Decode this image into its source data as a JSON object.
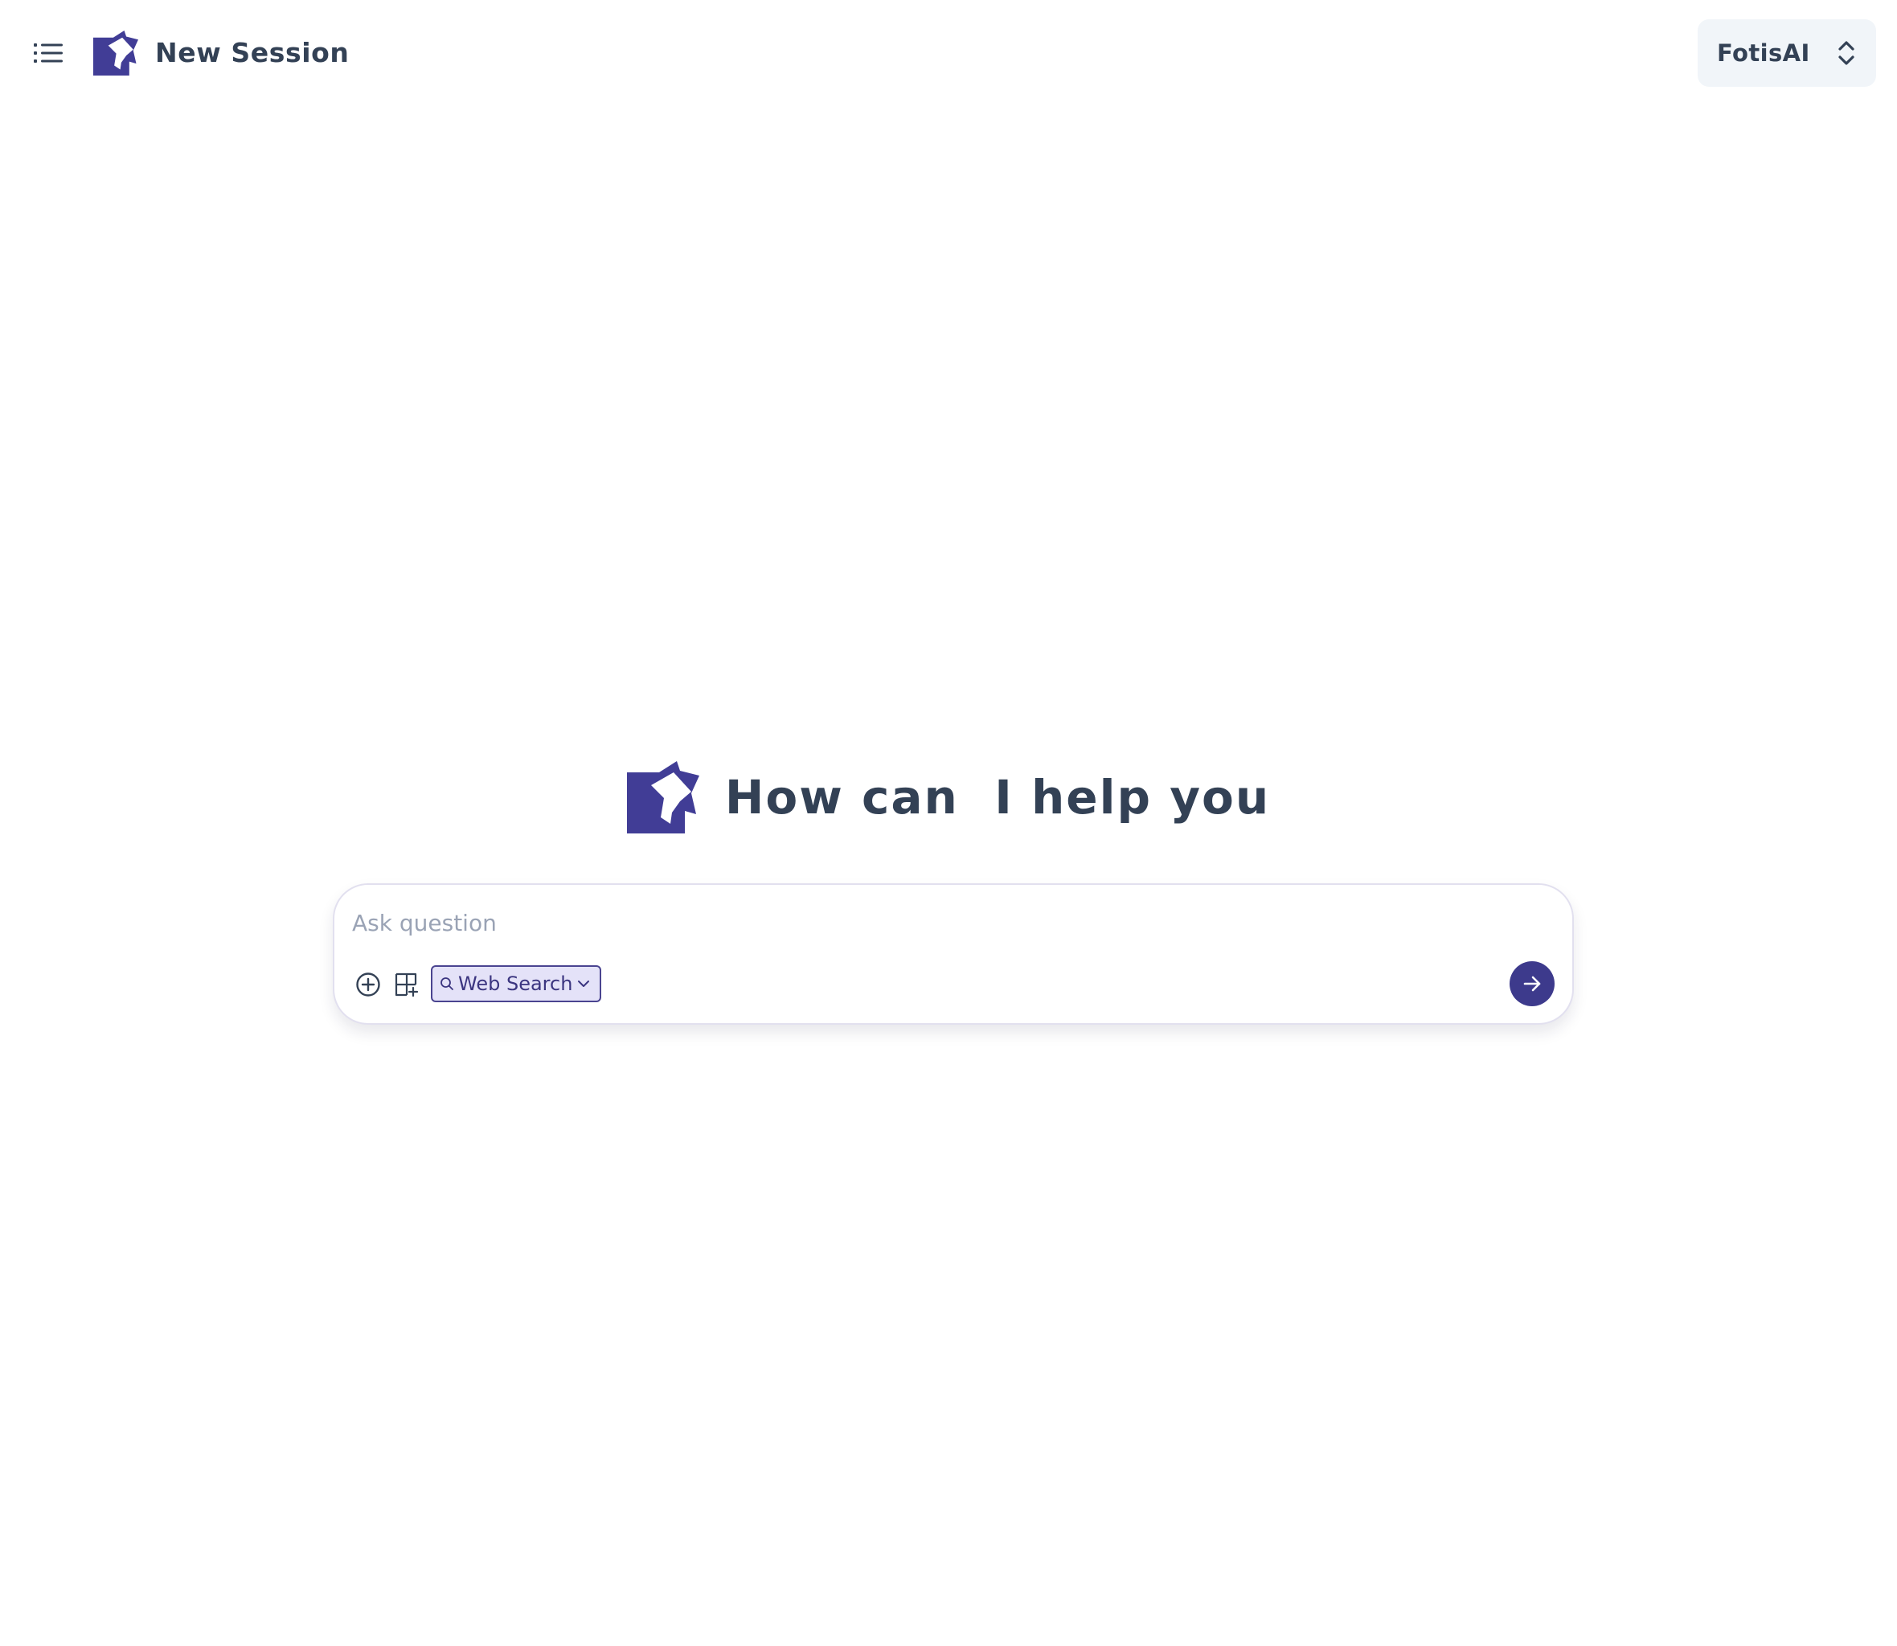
{
  "header": {
    "session_title": "New Session",
    "model_name": "FotisAI"
  },
  "hero": {
    "title": "How can  I help you"
  },
  "composer": {
    "placeholder": "Ask question",
    "value": "",
    "search_mode_label": "Web Search"
  },
  "icons": {
    "menu": "list-icon",
    "logo": "brand-logo-icon",
    "model_toggle": "chevron-up-down-icon",
    "add": "plus-circle-icon",
    "widget": "add-widget-icon",
    "search": "search-icon",
    "chevron": "chevron-down-icon",
    "send": "arrow-right-icon"
  },
  "colors": {
    "brand": "#3d3a8c",
    "text": "#334155",
    "chip_bg": "#e4e2f8",
    "model_bg": "#f1f5f9",
    "placeholder": "#9aa3b5"
  }
}
